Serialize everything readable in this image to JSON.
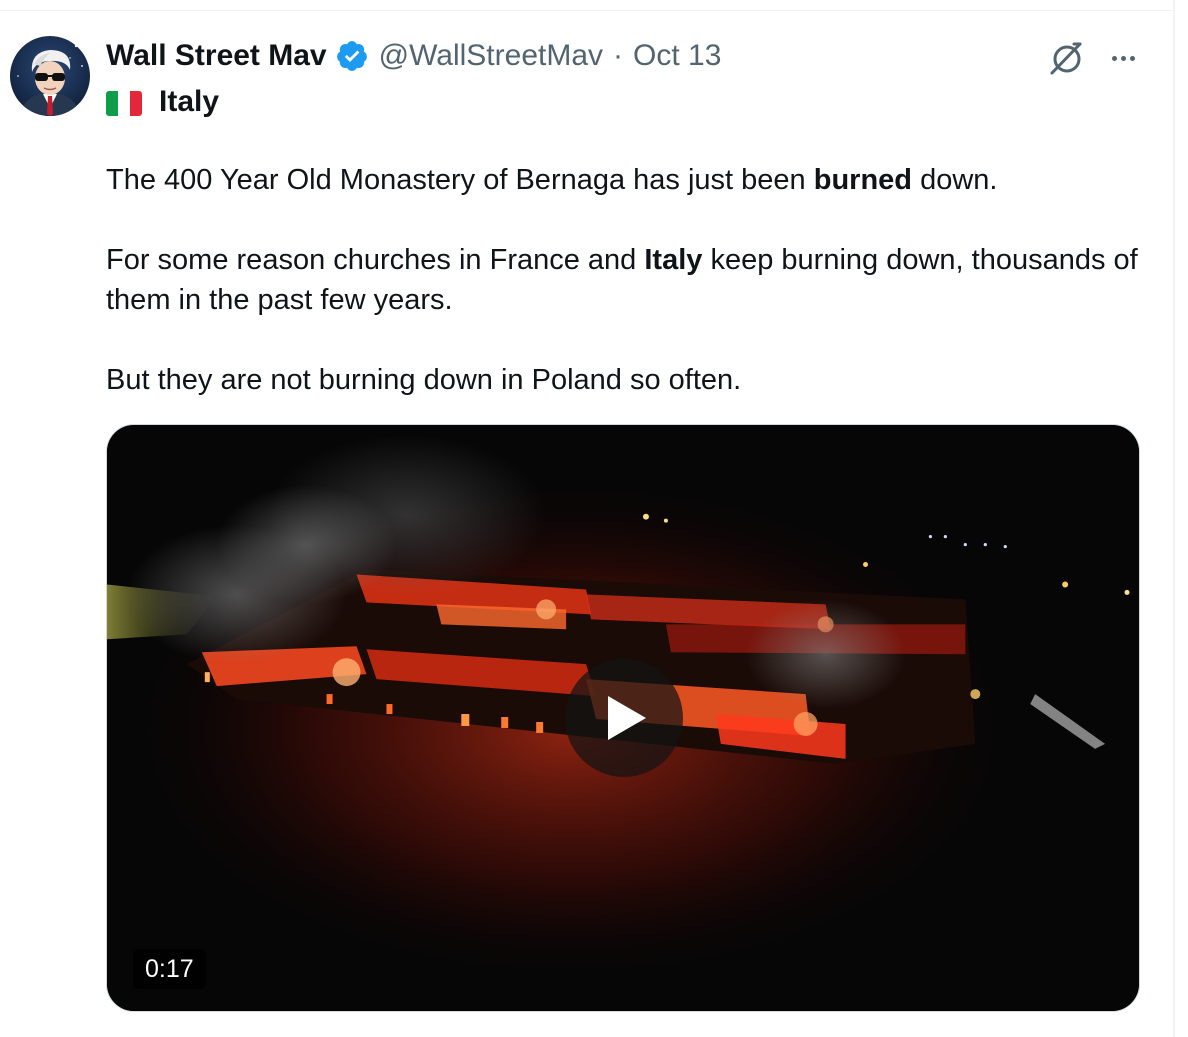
{
  "tweet": {
    "author": {
      "display_name": "Wall Street Mav",
      "verified": true,
      "handle": "@WallStreetMav"
    },
    "separator": "·",
    "date": "Oct 13",
    "location": {
      "flag_icon": "italy-flag-icon",
      "label": "Italy"
    },
    "paragraphs": [
      {
        "segments": [
          {
            "text": "The 400 Year Old Monastery of Bernaga has just been ",
            "bold": false
          },
          {
            "text": "burned",
            "bold": true
          },
          {
            "text": " down.",
            "bold": false
          }
        ]
      },
      {
        "segments": [
          {
            "text": "For some reason churches in France and ",
            "bold": false
          },
          {
            "text": "Italy",
            "bold": true
          },
          {
            "text": " keep burning down, thousands of them in the past few years.",
            "bold": false
          }
        ]
      },
      {
        "segments": [
          {
            "text": "But they are not burning down in Poland so often.",
            "bold": false
          }
        ]
      }
    ],
    "media": {
      "type": "video",
      "duration": "0:17",
      "play_icon": "play-icon"
    }
  },
  "icons": {
    "verified": "verified-badge-icon",
    "grok": "grok-icon",
    "more": "more-options-icon"
  },
  "colors": {
    "verified_blue": "#1d9bf0",
    "text_primary": "#0f1419",
    "text_secondary": "#536471",
    "border": "#cfd9de"
  }
}
